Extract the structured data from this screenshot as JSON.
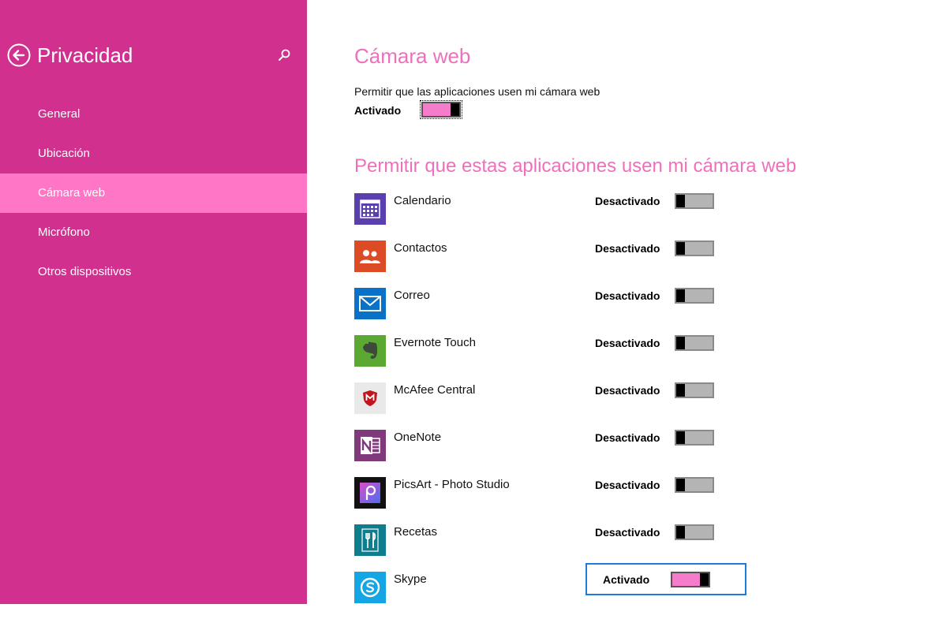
{
  "sidebar": {
    "title": "Privacidad",
    "items": [
      {
        "label": "General",
        "selected": false
      },
      {
        "label": "Ubicación",
        "selected": false
      },
      {
        "label": "Cámara web",
        "selected": true
      },
      {
        "label": "Micrófono",
        "selected": false
      },
      {
        "label": "Otros dispositivos",
        "selected": false
      }
    ],
    "back_icon": "back-arrow-icon",
    "search_icon": "search-icon",
    "bg_color": "#d1308e",
    "selected_color": "#ff76c6"
  },
  "main": {
    "title": "Cámara web",
    "master_description": "Permitir que las aplicaciones usen mi cámara web",
    "master_state": "Activado",
    "section_title": "Permitir que estas aplicaciones usen mi cámara web",
    "accent_color": "#ee70bc",
    "apps": [
      {
        "name": "Calendario",
        "state": "Desactivado",
        "on": false,
        "icon": "calendar-icon",
        "color": "#5b3fae"
      },
      {
        "name": "Contactos",
        "state": "Desactivado",
        "on": false,
        "icon": "people-icon",
        "color": "#dd4b26"
      },
      {
        "name": "Correo",
        "state": "Desactivado",
        "on": false,
        "icon": "mail-icon",
        "color": "#0a72c6"
      },
      {
        "name": "Evernote Touch",
        "state": "Desactivado",
        "on": false,
        "icon": "evernote-icon",
        "color": "#5ba932"
      },
      {
        "name": "McAfee Central",
        "state": "Desactivado",
        "on": false,
        "icon": "mcafee-icon",
        "color": "#e9e9e9"
      },
      {
        "name": "OneNote",
        "state": "Desactivado",
        "on": false,
        "icon": "onenote-icon",
        "color": "#80397b"
      },
      {
        "name": "PicsArt - Photo Studio",
        "state": "Desactivado",
        "on": false,
        "icon": "picsart-icon",
        "color": "#111111"
      },
      {
        "name": "Recetas",
        "state": "Desactivado",
        "on": false,
        "icon": "fork-knife-icon",
        "color": "#0e7e8f"
      },
      {
        "name": "Skype",
        "state": "Activado",
        "on": true,
        "icon": "skype-icon",
        "color": "#14a6e4"
      }
    ]
  }
}
